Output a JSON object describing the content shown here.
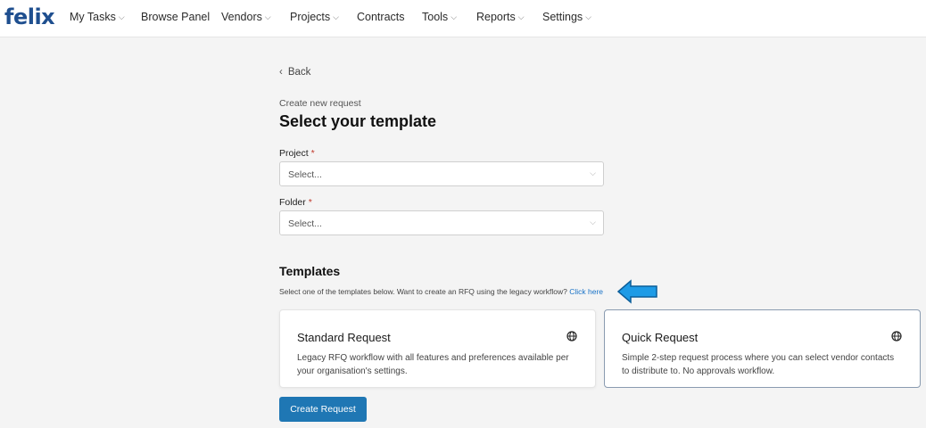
{
  "brand": {
    "logo": "felix"
  },
  "nav": {
    "my_tasks": "My Tasks",
    "browse_panel": "Browse Panel",
    "vendors": "Vendors",
    "projects": "Projects",
    "contracts": "Contracts",
    "tools": "Tools",
    "reports": "Reports",
    "settings": "Settings"
  },
  "page": {
    "back": "Back",
    "subtitle": "Create new request",
    "title": "Select your template"
  },
  "form": {
    "project_label": "Project",
    "project_value": "Select...",
    "folder_label": "Folder",
    "folder_value": "Select...",
    "required_marker": "*"
  },
  "templates": {
    "title": "Templates",
    "description": "Select one of the templates below. Want to create an RFQ using the legacy workflow?",
    "link": "Click here",
    "cards": [
      {
        "title": "Standard Request",
        "description": "Legacy RFQ workflow with all features and preferences available per your organisation's settings."
      },
      {
        "title": "Quick Request",
        "description": "Simple 2-step request process where you can select vendor contacts to distribute to. No approvals workflow."
      }
    ]
  },
  "actions": {
    "create_request": "Create Request"
  },
  "colors": {
    "brand": "#1f4f8f",
    "primary_button": "#1f77b4",
    "link": "#1a73c7",
    "callout_arrow": "#1e9be6",
    "required": "#c0392b"
  }
}
